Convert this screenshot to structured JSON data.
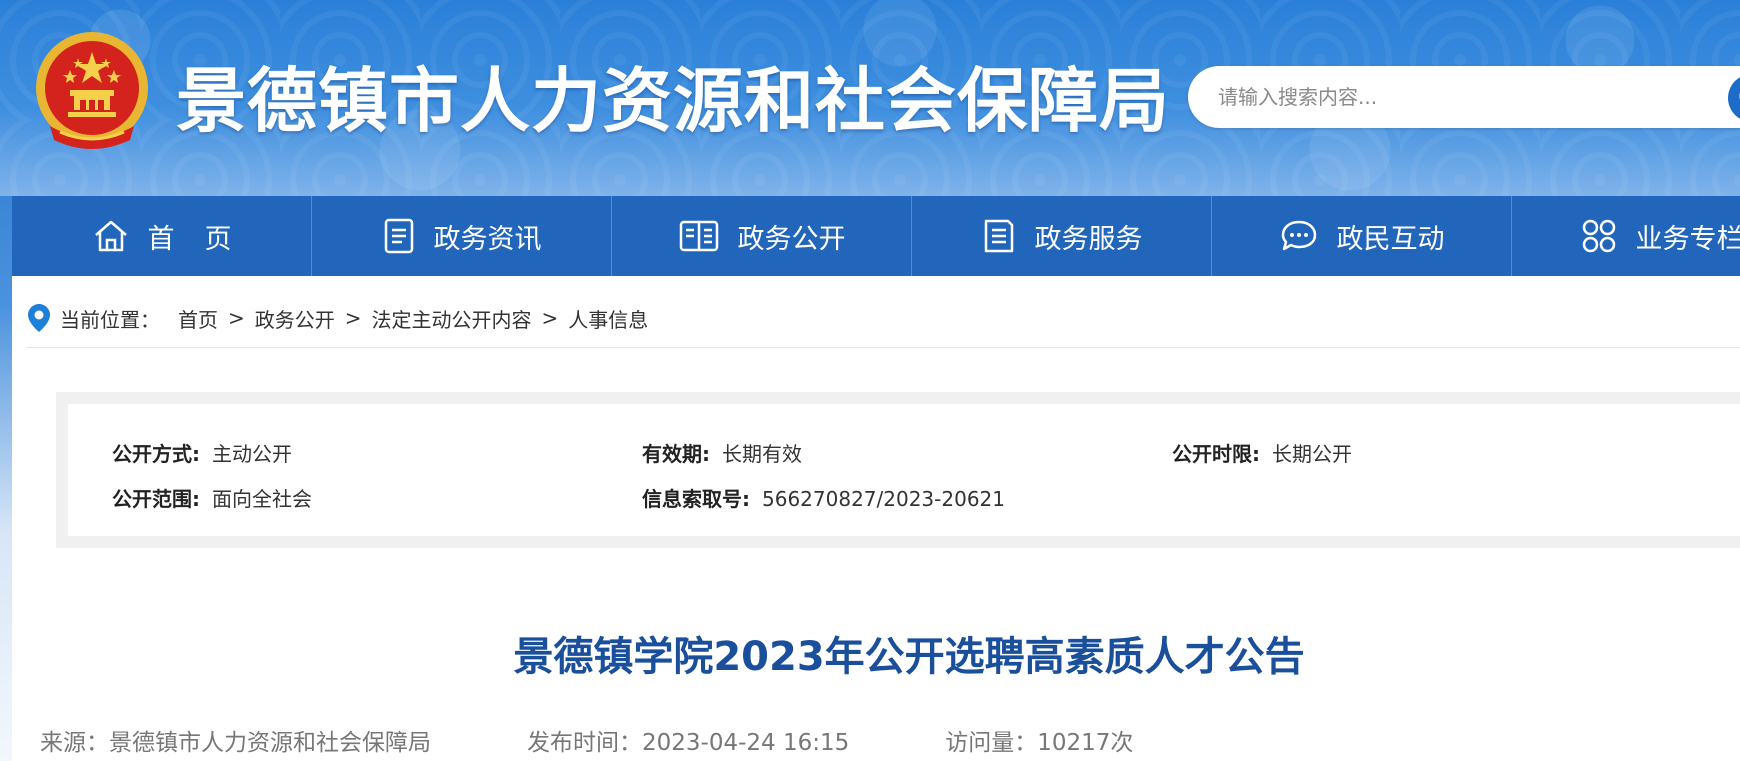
{
  "header": {
    "site_title": "景德镇市人力资源和社会保障局",
    "search_placeholder": "请输入搜索内容...",
    "brand_color": "#2a80d8"
  },
  "nav": {
    "items": [
      {
        "label": "首页",
        "icon": "home-icon"
      },
      {
        "label": "政务资讯",
        "icon": "document-icon"
      },
      {
        "label": "政务公开",
        "icon": "book-icon"
      },
      {
        "label": "政务服务",
        "icon": "list-icon"
      },
      {
        "label": "政民互动",
        "icon": "chat-icon"
      },
      {
        "label": "业务专栏",
        "icon": "grid-icon"
      }
    ],
    "bg_color": "#2266bb"
  },
  "breadcrumb": {
    "label": "当前位置：",
    "items": [
      "首页",
      "政务公开",
      "法定主动公开内容",
      "人事信息"
    ],
    "separator": ">"
  },
  "meta": {
    "mode_key": "公开方式:",
    "mode_val": "主动公开",
    "validity_key": "有效期:",
    "validity_val": "长期有效",
    "period_key": "公开时限:",
    "period_val": "长期公开",
    "scope_key": "公开范围:",
    "scope_val": "面向全社会",
    "index_key": "信息索取号:",
    "index_val": "566270827/2023-20621"
  },
  "article": {
    "title": "景德镇学院2023年公开选聘高素质人才公告",
    "source": "来源：景德镇市人力资源和社会保障局",
    "publish_time": "发布时间：2023-04-24 16:15",
    "views": "访问量：10217次",
    "title_color": "#1a4f9c"
  }
}
